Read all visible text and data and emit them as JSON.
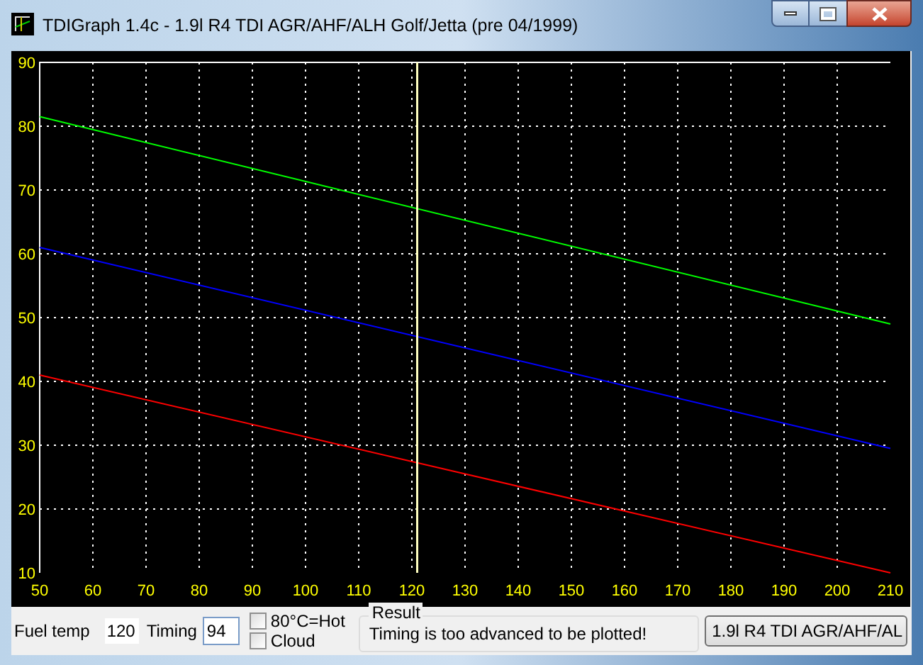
{
  "window": {
    "title": "TDIGraph 1.4c - 1.9l R4 TDI AGR/AHF/ALH Golf/Jetta (pre 04/1999)"
  },
  "chart": {
    "chart_data": {
      "type": "line",
      "x": [
        50,
        210
      ],
      "xlim": [
        50,
        210
      ],
      "ylim": [
        10,
        90
      ],
      "xticks": [
        50,
        60,
        70,
        80,
        90,
        100,
        110,
        120,
        130,
        140,
        150,
        160,
        170,
        180,
        190,
        200,
        210
      ],
      "yticks": [
        10,
        20,
        30,
        40,
        50,
        60,
        70,
        80,
        90
      ],
      "grid": true,
      "series": [
        {
          "color": "#00ff00",
          "values": [
            81.5,
            49
          ]
        },
        {
          "color": "#0000ff",
          "values": [
            61,
            29.5
          ]
        },
        {
          "color": "#ff0000",
          "values": [
            41,
            10
          ]
        }
      ],
      "ref_lines": [
        {
          "axis": "x",
          "value": 121,
          "color": "#ffffc0"
        }
      ]
    }
  },
  "controls": {
    "fuel_temp": {
      "label": "Fuel temp",
      "value": "120"
    },
    "timing": {
      "label": "Timing",
      "value": "94"
    },
    "checkboxes": [
      {
        "label": "80°C=Hot",
        "checked": false
      },
      {
        "label": "Cloud",
        "checked": false
      }
    ],
    "result": {
      "title": "Result",
      "text": "Timing is too advanced to be plotted!"
    },
    "engine_dropdown": {
      "value": "1.9l R4 TDI AGR/AHF/AL"
    }
  }
}
